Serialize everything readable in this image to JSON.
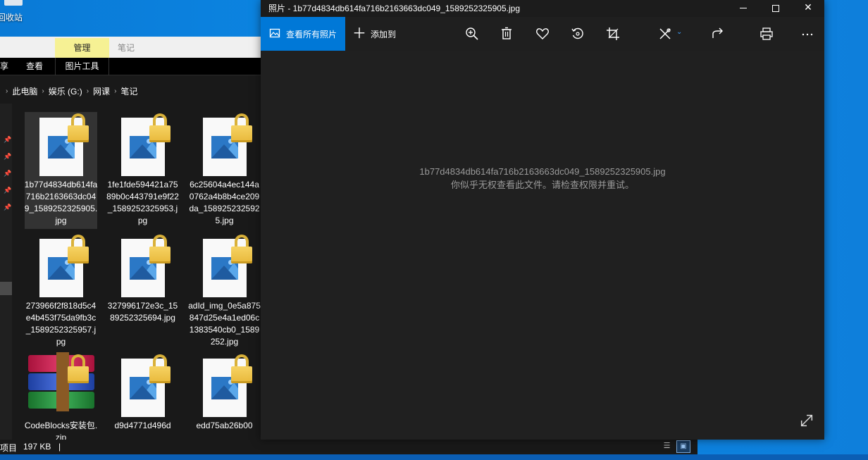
{
  "desktop": {
    "recycle_bin_label": "回收站"
  },
  "explorer": {
    "ribbon_top": {
      "manage": "管理",
      "notes": "笔记"
    },
    "ribbon_tabs": {
      "share": "享",
      "view": "查看",
      "picture_tools": "图片工具"
    },
    "breadcrumb": [
      "此电脑",
      "娱乐 (G:)",
      "网课",
      "笔记"
    ],
    "files": [
      {
        "name": "1b77d4834db614fa716b2163663dc049_1589252325905.jpg",
        "type": "image",
        "selected": true
      },
      {
        "name": "1fe1fde594421a7589b0c443791e9f22_1589252325953.jpg",
        "type": "image",
        "selected": false
      },
      {
        "name": "6c25604a4ec144a0762a4b8b4ce209da_1589252325925.jpg",
        "type": "image",
        "selected": false
      },
      {
        "name": "273966f2f818d5c4e4b453f75da9fb3c_1589252325957.jpg",
        "type": "image",
        "selected": false
      },
      {
        "name": "327996172e3c_1589252325694.jpg",
        "type": "image",
        "selected": false
      },
      {
        "name": "adId_img_0e5a875847d25e4a1ed06c1383540cb0_1589252.jpg",
        "type": "image",
        "selected": false
      },
      {
        "name": "CodeBlocks安装包.zip",
        "type": "archive",
        "selected": false
      },
      {
        "name": "d9d4771d496d",
        "type": "image",
        "selected": false
      },
      {
        "name": "edd75ab26b00",
        "type": "image",
        "selected": false
      }
    ],
    "status": {
      "count": "项目",
      "size": "197 KB",
      "cursor": "|"
    }
  },
  "photos": {
    "title": "照片 - 1b77d4834db614fa716b2163663dc049_1589252325905.jpg",
    "toolbar": {
      "see_all": "查看所有照片",
      "add_to": "添加到"
    },
    "message": {
      "filename": "1b77d4834db614fa716b2163663dc049_1589252325905.jpg",
      "error": "你似乎无权查看此文件。请检查权限并重试。"
    },
    "accent": "#0078d7"
  }
}
